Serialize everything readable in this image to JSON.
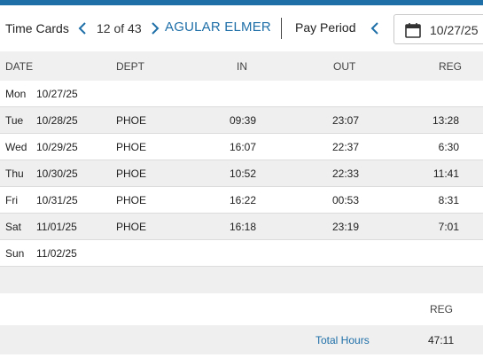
{
  "header": {
    "title": "Time Cards",
    "counter": "12 of 43",
    "employee_name": "AGULAR ELMER",
    "pay_period_label": "Pay Period",
    "date_value": "10/27/25"
  },
  "colors": {
    "accent": "#1e6fa8",
    "alt_row": "#efefef"
  },
  "icons": {
    "prev": "chevron-left-icon",
    "next": "chevron-right-icon",
    "calendar": "calendar-icon"
  },
  "columns": [
    "DATE",
    "DEPT",
    "IN",
    "OUT",
    "REG"
  ],
  "rows": [
    {
      "day": "Mon",
      "date": "10/27/25",
      "dept": "",
      "in": "",
      "out": "",
      "reg": ""
    },
    {
      "day": "Tue",
      "date": "10/28/25",
      "dept": "PHOE",
      "in": "09:39",
      "out": "23:07",
      "reg": "13:28"
    },
    {
      "day": "Wed",
      "date": "10/29/25",
      "dept": "PHOE",
      "in": "16:07",
      "out": "22:37",
      "reg": "6:30"
    },
    {
      "day": "Thu",
      "date": "10/30/25",
      "dept": "PHOE",
      "in": "10:52",
      "out": "22:33",
      "reg": "11:41"
    },
    {
      "day": "Fri",
      "date": "10/31/25",
      "dept": "PHOE",
      "in": "16:22",
      "out": "00:53",
      "reg": "8:31"
    },
    {
      "day": "Sat",
      "date": "11/01/25",
      "dept": "PHOE",
      "in": "16:18",
      "out": "23:19",
      "reg": "7:01"
    },
    {
      "day": "Sun",
      "date": "11/02/25",
      "dept": "",
      "in": "",
      "out": "",
      "reg": ""
    }
  ],
  "totals": {
    "column_label": "REG",
    "label": "Total Hours",
    "reg": "47:11"
  }
}
